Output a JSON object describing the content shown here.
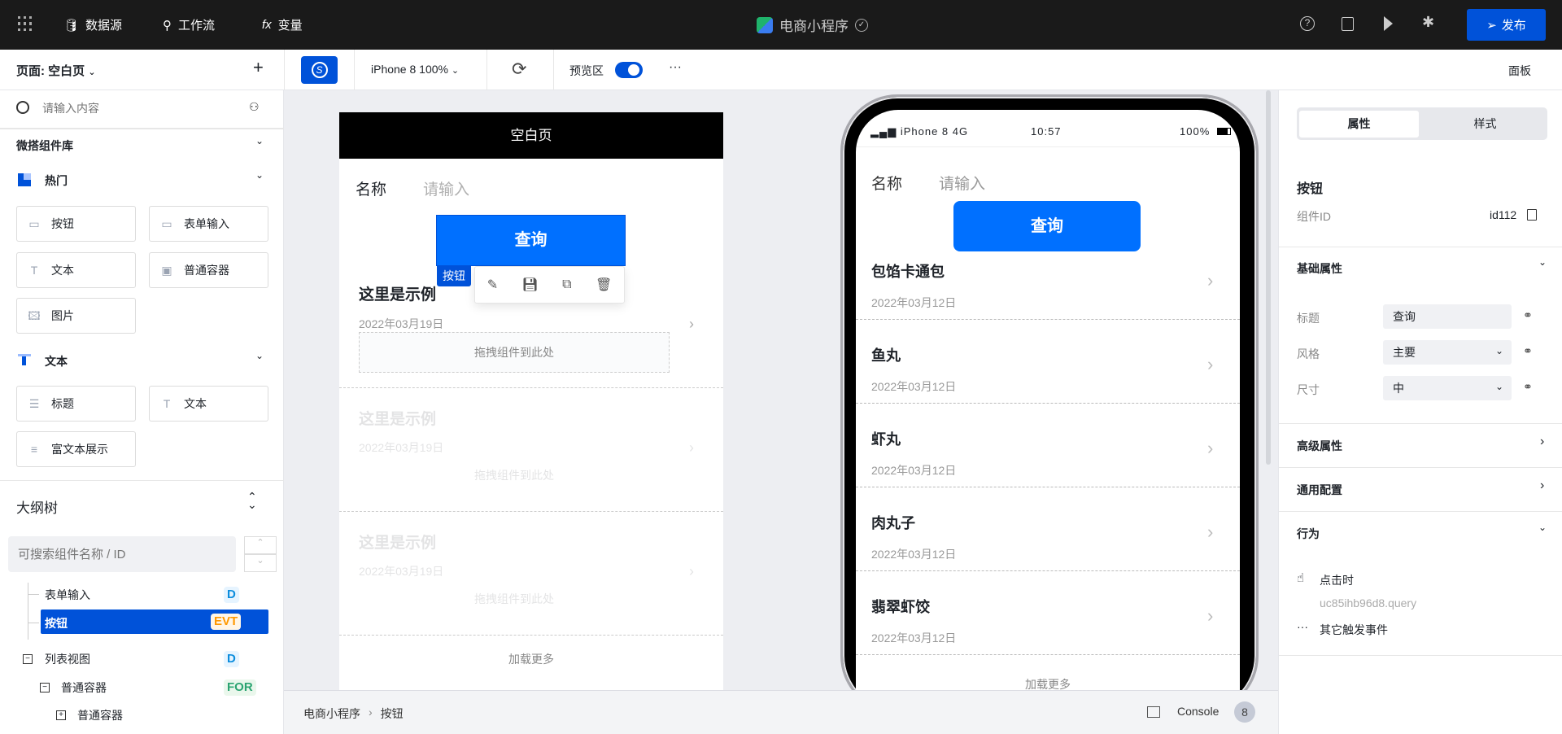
{
  "topbar": {
    "nav": [
      {
        "label": "数据源",
        "icon": "database-icon"
      },
      {
        "label": "工作流",
        "icon": "workflow-icon"
      },
      {
        "label": "变量",
        "icon": "fx-icon"
      }
    ],
    "app_title": "电商小程序",
    "publish_label": "发布",
    "accent": "#0052d9"
  },
  "toolbar": {
    "page_label": "页面: 空白页",
    "device": "iPhone 8 100%",
    "preview_label": "预览区",
    "preview_on": true,
    "more": "···",
    "panel_label": "面板"
  },
  "left": {
    "search_placeholder": "请输入内容",
    "library_title": "微搭组件库",
    "groups": [
      {
        "title": "热门",
        "items": [
          "按钮",
          "表单输入",
          "文本",
          "普通容器",
          "图片"
        ]
      },
      {
        "title": "文本",
        "items": [
          "标题",
          "文本",
          "富文本展示"
        ]
      }
    ],
    "outline": {
      "title": "大纲树",
      "search_placeholder": "可搜索组件名称 / ID",
      "nodes": [
        {
          "label": "表单输入",
          "badge": "D"
        },
        {
          "label": "按钮",
          "badge": "EVT",
          "selected": true
        },
        {
          "label": "列表视图",
          "badge": "D"
        },
        {
          "label": "普通容器",
          "badge": "FOR"
        },
        {
          "label": "普通容器",
          "badge": ""
        }
      ]
    }
  },
  "designer": {
    "page_title": "空白页",
    "field_label": "名称",
    "field_placeholder": "请输入",
    "button_label": "查询",
    "selected_tag": "按钮",
    "items": [
      {
        "title": "这里是示例",
        "date": "2022年03月19日",
        "drop": "拖拽组件到此处"
      },
      {
        "title": "这里是示例",
        "date": "2022年03月19日",
        "drop": "拖拽组件到此处"
      },
      {
        "title": "这里是示例",
        "date": "2022年03月19日",
        "drop": "拖拽组件到此处"
      }
    ],
    "load_more": "加载更多"
  },
  "phone": {
    "carrier": "iPhone 8  4G",
    "time": "10:57",
    "battery": "100%",
    "field_label": "名称",
    "field_placeholder": "请输入",
    "button_label": "查询",
    "items": [
      {
        "title": "包馅卡通包",
        "date": "2022年03月12日"
      },
      {
        "title": "鱼丸",
        "date": "2022年03月12日"
      },
      {
        "title": "虾丸",
        "date": "2022年03月12日"
      },
      {
        "title": "肉丸子",
        "date": "2022年03月12日"
      },
      {
        "title": "翡翠虾饺",
        "date": "2022年03月12日"
      }
    ],
    "load_more": "加载更多"
  },
  "bottombar": {
    "breadcrumb": [
      "电商小程序",
      "按钮"
    ],
    "console_label": "Console",
    "console_count": "8"
  },
  "right": {
    "tabs": [
      "属性",
      "样式"
    ],
    "component_name": "按钮",
    "id_label": "组件ID",
    "id_value": "id112",
    "basic_title": "基础属性",
    "props": [
      {
        "label": "标题",
        "value": "查询"
      },
      {
        "label": "风格",
        "value": "主要"
      },
      {
        "label": "尺寸",
        "value": "中"
      }
    ],
    "advanced_title": "高级属性",
    "common_title": "通用配置",
    "behavior_title": "行为",
    "event_label": "点击时",
    "event_action": "uc85ihb96d8.query",
    "other_events": "其它触发事件"
  }
}
